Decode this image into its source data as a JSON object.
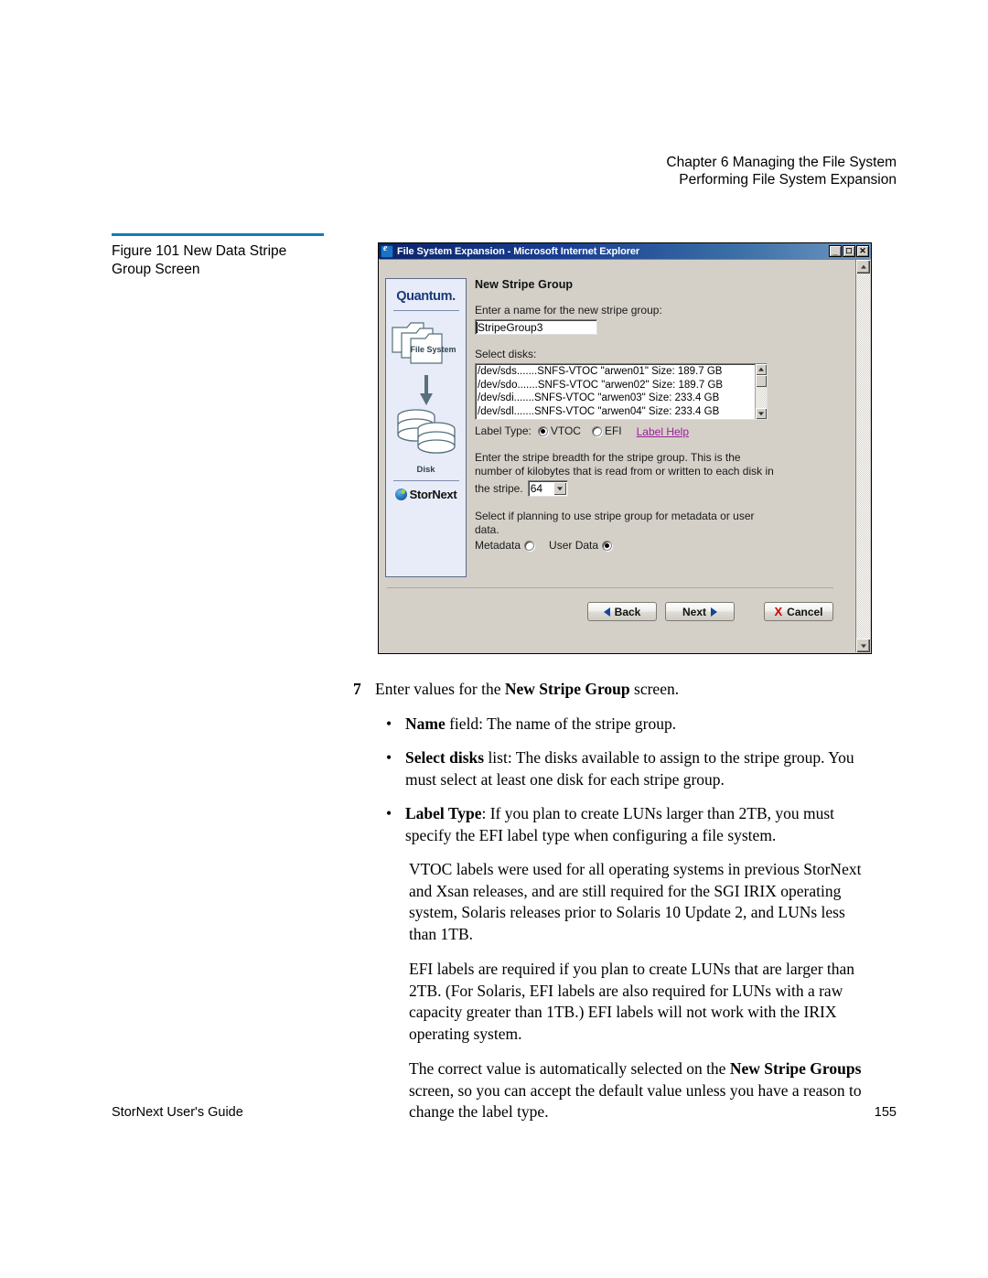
{
  "page_header": {
    "line1": "Chapter 6  Managing the File System",
    "line2": "Performing File System Expansion"
  },
  "figure": {
    "caption_line1": "Figure 101  New Data Stripe",
    "caption_line2": "Group Screen",
    "rule_color": "#1579c0"
  },
  "ie_window": {
    "title": "File System Expansion - Microsoft Internet Explorer",
    "minimize_label": "_",
    "maximize_label": "❑",
    "close_label": "✕"
  },
  "sidebar": {
    "brand": "Quantum.",
    "file_system_label": "File System",
    "disk_label": "Disk",
    "product_label": "StorNext"
  },
  "dialog": {
    "heading": "New Stripe Group",
    "name_prompt": "Enter a name for the new stripe group:",
    "name_value": "StripeGroup3",
    "select_disks_label": "Select disks:",
    "disks": [
      "/dev/sds.......SNFS-VTOC \"arwen01\" Size: 189.7 GB",
      "/dev/sdo.......SNFS-VTOC \"arwen02\" Size: 189.7 GB",
      "/dev/sdi.......SNFS-VTOC \"arwen03\" Size: 233.4 GB",
      "/dev/sdl.......SNFS-VTOC \"arwen04\" Size: 233.4 GB"
    ],
    "label_type_label": "Label Type:",
    "label_type_vtoc": "VTOC",
    "label_type_efi": "EFI",
    "label_type_selected": "VTOC",
    "label_help_link": "Label Help",
    "label_help_color": "#9c1f9c",
    "breadth_text_line1": "Enter the stripe breadth for the stripe group. This is the",
    "breadth_text_line2": "number of kilobytes that is read from or written to each disk in",
    "breadth_text_line3": "the stripe.",
    "breadth_value": "64",
    "usage_text_line1": "Select if planning to use stripe group for metadata or user",
    "usage_text_line2": "data.",
    "metadata_label": "Metadata",
    "user_data_label": "User Data",
    "usage_selected": "User Data",
    "buttons": {
      "back": "Back",
      "next": "Next",
      "cancel": "Cancel",
      "cancel_mark": "X"
    }
  },
  "body": {
    "step_number": "7",
    "step_a": "Enter values for the ",
    "step_b": "New Stripe Group",
    "step_c": " screen.",
    "bullet_dot": "•",
    "bullets": [
      {
        "bold": "Name",
        "rest": " field: The name of the stripe group."
      },
      {
        "bold": "Select disks",
        "rest": " list: The disks available to assign to the stripe group. You must select at least one disk for each stripe group."
      },
      {
        "bold": "Label Type",
        "rest": ": If you plan to create LUNs larger than 2TB, you must specify the EFI label type when configuring a file system."
      }
    ],
    "para1": "VTOC labels were used for all operating systems in previous StorNext and Xsan releases, and are still required for the SGI IRIX operating system, Solaris releases prior to Solaris 10 Update 2, and LUNs less than 1TB.",
    "para2": "EFI labels are required if you plan to create LUNs that are larger than 2TB. (For Solaris, EFI labels are also required for LUNs with a raw capacity greater than 1TB.) EFI labels will not work with the IRIX operating system.",
    "para3_a": "The correct value is automatically selected on the ",
    "para3_b": "New Stripe Groups",
    "para3_c": " screen, so you can accept the default value unless you have a reason to change the label type."
  },
  "footer": {
    "guide": "StorNext User's Guide",
    "page_number": "155"
  }
}
